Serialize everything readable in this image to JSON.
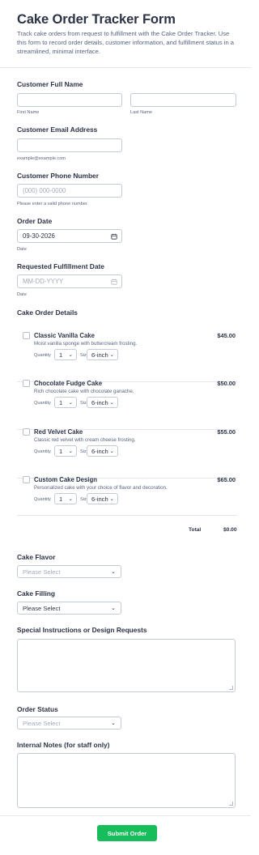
{
  "header": {
    "title": "Cake Order Tracker Form",
    "subtitle": "Track cake orders from request to fulfillment with the Cake Order Tracker. Use this form to record order details, customer information, and fulfillment status in a streamlined, minimal interface."
  },
  "customer_name": {
    "label": "Customer Full Name",
    "first_sublabel": "First Name",
    "last_sublabel": "Last Name",
    "first_value": "",
    "last_value": ""
  },
  "email": {
    "label": "Customer Email Address",
    "value": "",
    "sublabel": "example@example.com"
  },
  "phone": {
    "label": "Customer Phone Number",
    "placeholder": "(000) 000-0000",
    "sublabel": "Please enter a valid phone number."
  },
  "order_date": {
    "label": "Order Date",
    "value": "09-30-2026",
    "sublabel": "Date"
  },
  "fulfillment_date": {
    "label": "Requested Fulfillment Date",
    "placeholder": "MM-DD-YYYY",
    "sublabel": "Date"
  },
  "cake_details": {
    "label": "Cake Order Details",
    "quantity_label": "Quantity",
    "size_label": "Size",
    "products": [
      {
        "name": "Classic Vanilla Cake",
        "description": "Moist vanilla sponge with buttercream frosting.",
        "price": "$45.00",
        "quantity": "1",
        "size": "6-inch",
        "checked": false
      },
      {
        "name": "Chocolate Fudge Cake",
        "description": "Rich chocolate cake with chocolate ganache.",
        "price": "$50.00",
        "quantity": "1",
        "size": "6-inch",
        "checked": false
      },
      {
        "name": "Red Velvet Cake",
        "description": "Classic red velvet with cream cheese frosting.",
        "price": "$55.00",
        "quantity": "1",
        "size": "6-inch",
        "checked": false
      },
      {
        "name": "Custom Cake Design",
        "description": "Personalized cake with your choice of flavor and decoration.",
        "price": "$65.00",
        "quantity": "1",
        "size": "6-inch",
        "checked": false
      }
    ],
    "total_label": "Total",
    "total_value": "$0.00"
  },
  "flavor": {
    "label": "Cake Flavor",
    "value": "Please Select"
  },
  "filling": {
    "label": "Cake Filling",
    "value": "Please Select"
  },
  "instructions": {
    "label": "Special Instructions or Design Requests",
    "value": ""
  },
  "status": {
    "label": "Order Status",
    "value": "Please Select"
  },
  "notes": {
    "label": "Internal Notes (for staff only)",
    "value": ""
  },
  "submit": {
    "label": "Submit Order"
  },
  "colors": {
    "primary_text": "#2c3345",
    "secondary_text": "#57647e",
    "border": "#c3cad8",
    "submit_bg": "#18bd5b",
    "placeholder": "#a3abbd"
  },
  "icons": {
    "date": "calendar-icon",
    "dropdown": "chevron-down-icon"
  }
}
